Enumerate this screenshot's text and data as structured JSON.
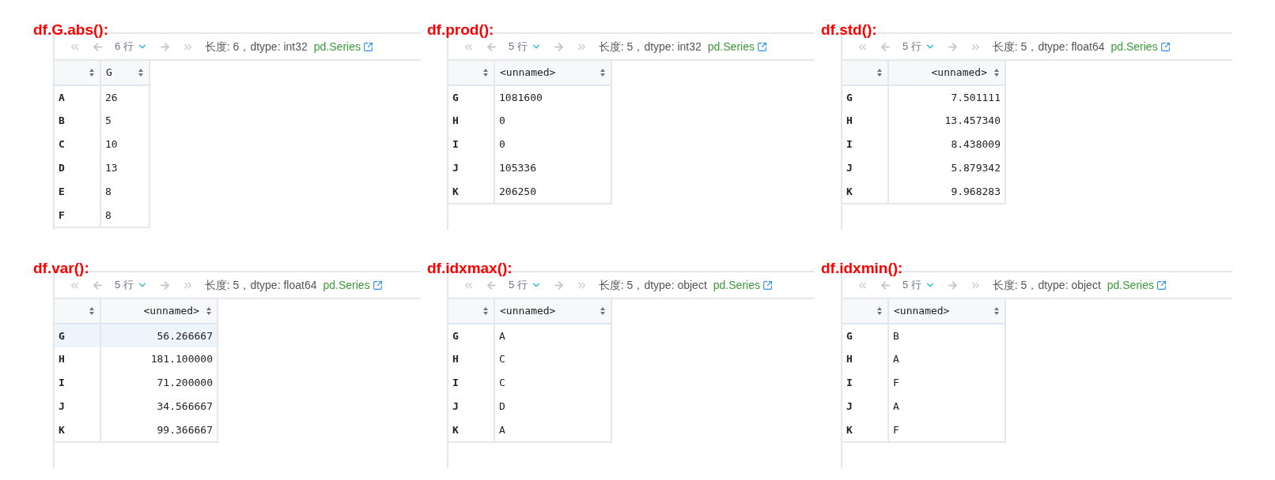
{
  "panels": [
    {
      "label": "df.G.abs():",
      "row_count": "6 行",
      "summary": "长度: 6，dtype: int32",
      "type_link": "pd.Series",
      "kind": "text",
      "columns": [
        "",
        "G"
      ],
      "rows": [
        {
          "index": "A",
          "value": "26",
          "selected": false
        },
        {
          "index": "B",
          "value": "5",
          "selected": false
        },
        {
          "index": "C",
          "value": "10",
          "selected": false
        },
        {
          "index": "D",
          "value": "13",
          "selected": false
        },
        {
          "index": "E",
          "value": "8",
          "selected": false
        },
        {
          "index": "F",
          "value": "8",
          "selected": false
        }
      ]
    },
    {
      "label": "df.prod():",
      "row_count": "5 行",
      "summary": "长度: 5，dtype: int32",
      "type_link": "pd.Series",
      "kind": "text",
      "columns": [
        "",
        "<unnamed>"
      ],
      "rows": [
        {
          "index": "G",
          "value": "1081600",
          "selected": false
        },
        {
          "index": "H",
          "value": "0",
          "selected": false
        },
        {
          "index": "I",
          "value": "0",
          "selected": false
        },
        {
          "index": "J",
          "value": "105336",
          "selected": false
        },
        {
          "index": "K",
          "value": "206250",
          "selected": false
        }
      ]
    },
    {
      "label": "df.std():",
      "row_count": "5 行",
      "summary": "长度: 5，dtype: float64",
      "type_link": "pd.Series",
      "kind": "float",
      "columns": [
        "",
        "<unnamed>"
      ],
      "rows": [
        {
          "index": "G",
          "value": "7.501111",
          "selected": false
        },
        {
          "index": "H",
          "value": "13.457340",
          "selected": false
        },
        {
          "index": "I",
          "value": "8.438009",
          "selected": false
        },
        {
          "index": "J",
          "value": "5.879342",
          "selected": false
        },
        {
          "index": "K",
          "value": "9.968283",
          "selected": false
        }
      ]
    },
    {
      "label": "df.var():",
      "row_count": "5 行",
      "summary": "长度: 5，dtype: float64",
      "type_link": "pd.Series",
      "kind": "float",
      "columns": [
        "",
        "<unnamed>"
      ],
      "rows": [
        {
          "index": "G",
          "value": "56.266667",
          "selected": true
        },
        {
          "index": "H",
          "value": "181.100000",
          "selected": false
        },
        {
          "index": "I",
          "value": "71.200000",
          "selected": false
        },
        {
          "index": "J",
          "value": "34.566667",
          "selected": false
        },
        {
          "index": "K",
          "value": "99.366667",
          "selected": false
        }
      ]
    },
    {
      "label": "df.idxmax():",
      "row_count": "5 行",
      "summary": "长度: 5，dtype: object",
      "type_link": "pd.Series",
      "kind": "text",
      "columns": [
        "",
        "<unnamed>"
      ],
      "rows": [
        {
          "index": "G",
          "value": "A",
          "selected": false
        },
        {
          "index": "H",
          "value": "C",
          "selected": false
        },
        {
          "index": "I",
          "value": "C",
          "selected": false
        },
        {
          "index": "J",
          "value": "D",
          "selected": false
        },
        {
          "index": "K",
          "value": "A",
          "selected": false
        }
      ]
    },
    {
      "label": "df.idxmin():",
      "row_count": "5 行",
      "summary": "长度: 5，dtype: object",
      "type_link": "pd.Series",
      "kind": "text",
      "columns": [
        "",
        "<unnamed>"
      ],
      "rows": [
        {
          "index": "G",
          "value": "B",
          "selected": false
        },
        {
          "index": "H",
          "value": "A",
          "selected": false
        },
        {
          "index": "I",
          "value": "F",
          "selected": false
        },
        {
          "index": "J",
          "value": "A",
          "selected": false
        },
        {
          "index": "K",
          "value": "F",
          "selected": false
        }
      ]
    }
  ]
}
